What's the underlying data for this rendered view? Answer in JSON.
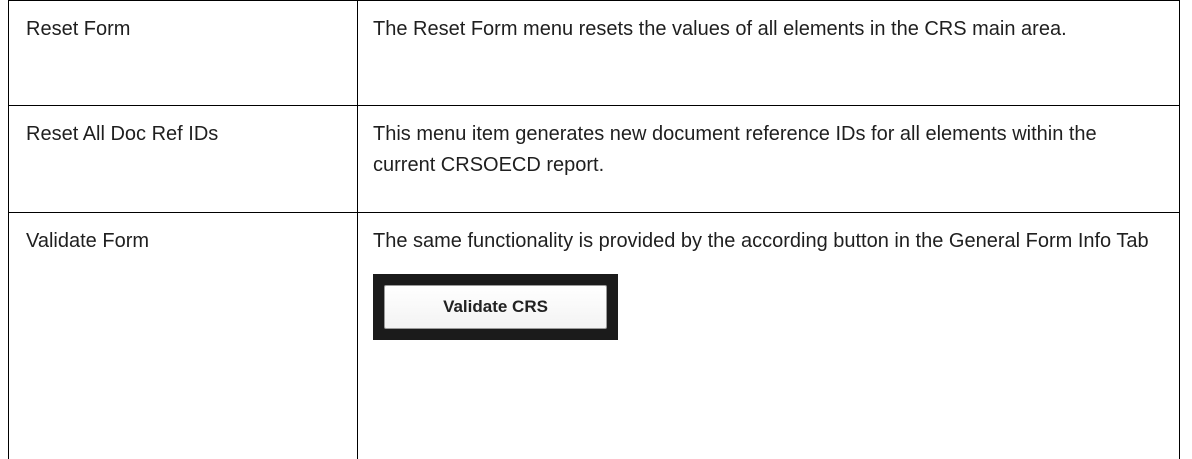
{
  "rows": [
    {
      "term": "Reset Form",
      "description": "The Reset Form menu resets the values of all elements in the CRS main area."
    },
    {
      "term": "Reset All Doc Ref IDs",
      "description": "This menu item generates new document reference IDs for all elements within the current CRSOECD report."
    },
    {
      "term": "Validate Form",
      "description": "The same functionality is provided by the according button in the General Form Info Tab",
      "screenshot_button_label": "Validate CRS"
    }
  ]
}
